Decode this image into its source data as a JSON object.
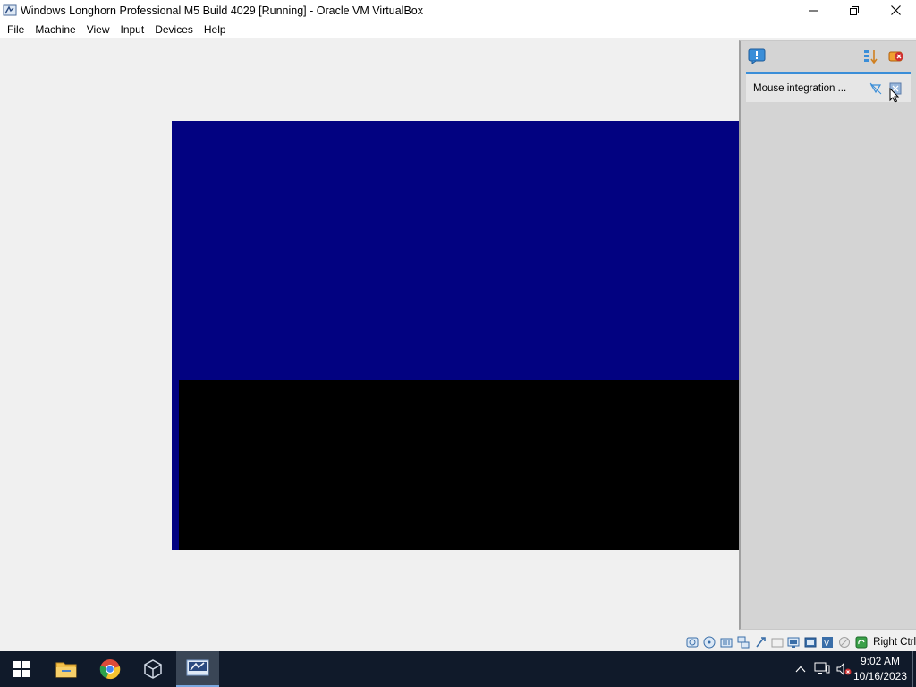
{
  "window": {
    "title": "Windows Longhorn Professional M5 Build 4029 [Running] - Oracle VM VirtualBox",
    "icon": "virtualbox-vm-icon",
    "controls": [
      "minimize-icon",
      "restore-icon",
      "close-icon"
    ]
  },
  "menubar": {
    "items": [
      {
        "label": "File"
      },
      {
        "label": "Machine"
      },
      {
        "label": "View"
      },
      {
        "label": "Input"
      },
      {
        "label": "Devices"
      },
      {
        "label": "Help"
      }
    ]
  },
  "vm_display": {
    "colors": {
      "top": "#020281",
      "bottom": "#000000"
    }
  },
  "notification_panel": {
    "top_icons": [
      "notification-center-icon",
      "sort-icon",
      "close-all-icon"
    ],
    "messages": [
      {
        "text": "Mouse integration ...",
        "icons": [
          "mouse-integration-icon",
          "dismiss-icon"
        ]
      }
    ],
    "accent": "#3a8ed8"
  },
  "statusbar": {
    "icons": [
      "hard-disk-icon",
      "optical-drive-icon",
      "audio-icon",
      "network-icon",
      "usb-icon",
      "shared-folders-icon",
      "display-icon",
      "recording-icon",
      "cpu-icon",
      "mouse-integration-status-icon",
      "host-key-icon"
    ],
    "host_key": "Right Ctrl"
  },
  "taskbar": {
    "apps": [
      {
        "name": "start-button",
        "icon": "windows-logo-icon"
      },
      {
        "name": "file-explorer",
        "icon": "folder-icon"
      },
      {
        "name": "chrome",
        "icon": "chrome-icon"
      },
      {
        "name": "virtualbox-manager",
        "icon": "virtualbox-icon"
      },
      {
        "name": "virtualbox-vm",
        "icon": "virtualbox-vm-icon",
        "active": true
      }
    ],
    "tray_icons": [
      "chevron-up-icon",
      "network-tray-icon",
      "volume-muted-icon"
    ],
    "clock": {
      "time": "9:02 AM",
      "date": "10/16/2023"
    }
  }
}
